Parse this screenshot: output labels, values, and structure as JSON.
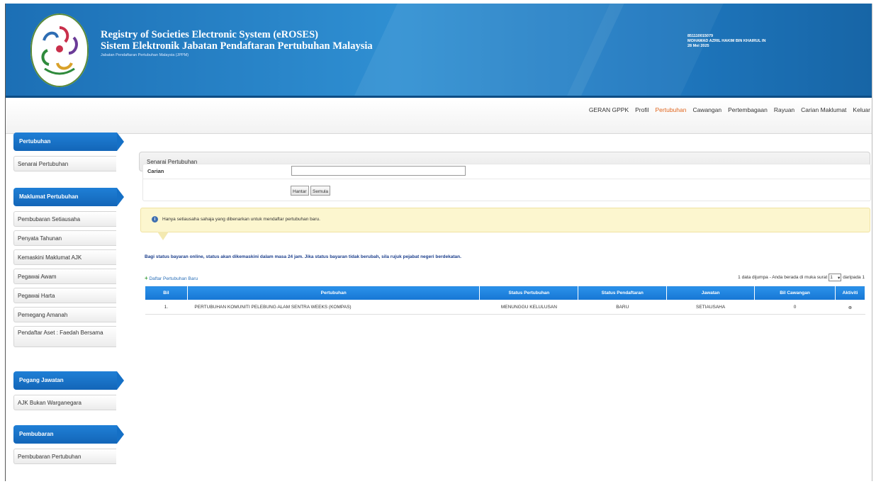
{
  "header": {
    "title_en": "Registry of Societies Electronic System (eROSES)",
    "title_ms": "Sistem Elektronik Jabatan Pendaftaran Pertubuhan Malaysia",
    "subtitle": "Jabatan Pendaftaran Pertubuhan Malaysia (JPPM)",
    "user_id": "851110015079",
    "user_name": "MOHAMAD AZRIL HAKIM BIN KHAIRUL IN",
    "date": "28 Mei 2025"
  },
  "topnav": {
    "items": [
      "GERAN GPPK",
      "Profil",
      "Pertubuhan",
      "Cawangan",
      "Pertembagaan",
      "Rayuan",
      "Carian Maklumat",
      "Keluar"
    ],
    "active": "Pertubuhan"
  },
  "sidebar": {
    "sections": [
      {
        "title": "Pertubuhan",
        "items": [
          "Senarai Pertubuhan"
        ]
      },
      {
        "title": "Maklumat Pertubuhan",
        "items": [
          "Pembubaran Setiausaha",
          "Penyata Tahunan",
          "Kemaskini Maklumat AJK",
          "Pegawai Awam",
          "Pegawai Harta",
          "Pemegang Amanah",
          "Pendaftar Aset : Faedah Bersama"
        ]
      },
      {
        "title": "Pegang Jawatan",
        "items": [
          "AJK Bukan Warganegara"
        ]
      },
      {
        "title": "Pembubaran",
        "items": [
          "Pembubaran Pertubuhan"
        ]
      }
    ]
  },
  "main": {
    "breadcrumb": "Senarai Pertubuhan",
    "search": {
      "label": "Carian",
      "value": "",
      "search_button": "Hantar",
      "reset_button": "Semula"
    },
    "notice": "Hanya setiausaha sahaja yang dibenarkan untuk mendaftar pertubuhan baru.",
    "warning": "Bagi status bayaran online, status akan dikemaskini dalam masa 24 jam. Jika status bayaran tidak berubah, sila rujuk pejabat negeri berdekatan.",
    "add_link": "Daftar Pertubuhan Baru",
    "paging": {
      "prefix": "1 data dijumpa - Anda berada di muka surat",
      "page": "1",
      "suffix": "daripada 1"
    },
    "table": {
      "columns": [
        "Bil",
        "Pertubuhan",
        "Status Pertubuhan",
        "Status Pendaftaran",
        "Jawatan",
        "Bil Cawangan",
        "Aktiviti"
      ],
      "rows": [
        {
          "bil": "1.",
          "pertubuhan": "PERTUBUHAN KOMUNITI PELEBUNG ALAM SENTRA WEEKS (KOMPAS)",
          "status_pertubuhan": "MENUNGGU KELULUSAN",
          "status_pendaftaran": "BARU",
          "jawatan": "SETIAUSAHA",
          "bil_cawangan": "0",
          "aktiviti": "⊕"
        }
      ]
    }
  }
}
